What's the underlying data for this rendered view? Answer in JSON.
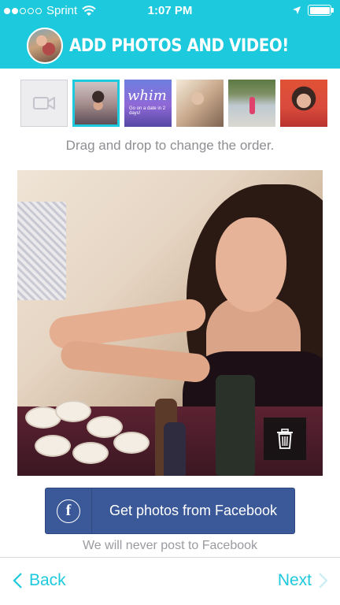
{
  "status_bar": {
    "carrier": "Sprint",
    "time": "1:07 PM"
  },
  "header": {
    "title": "ADD PHOTOS AND VIDEO!"
  },
  "thumbnails": {
    "whim_text": "whim",
    "whim_sub": "Go on a date in 2 days!"
  },
  "hint": "Drag and drop to change the order.",
  "facebook_button": {
    "icon_letter": "f",
    "label": "Get photos from Facebook"
  },
  "disclaimer": "We will never post to Facebook",
  "nav": {
    "back_label": "Back",
    "next_label": "Next"
  },
  "colors": {
    "accent": "#1dc9dc",
    "facebook": "#3b5998"
  }
}
